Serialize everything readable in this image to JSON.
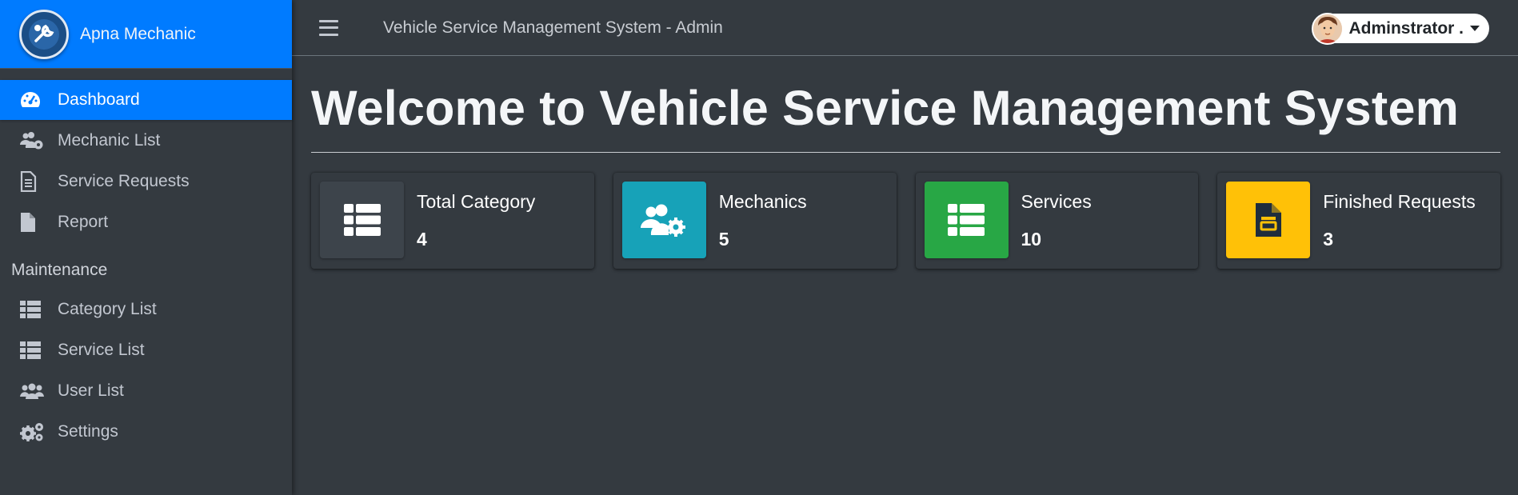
{
  "brand": {
    "name": "Apna Mechanic"
  },
  "header": {
    "title": "Vehicle Service Management System - Admin",
    "user_name": "Adminstrator ."
  },
  "sidebar": {
    "items": [
      {
        "label": "Dashboard",
        "icon": "tachometer-icon"
      },
      {
        "label": "Mechanic List",
        "icon": "users-cog-icon"
      },
      {
        "label": "Service Requests",
        "icon": "file-alt-icon"
      },
      {
        "label": "Report",
        "icon": "file-icon"
      }
    ],
    "section_header": "Maintenance",
    "maintenance_items": [
      {
        "label": "Category List",
        "icon": "th-list-icon"
      },
      {
        "label": "Service List",
        "icon": "th-list-icon"
      },
      {
        "label": "User List",
        "icon": "users-icon"
      },
      {
        "label": "Settings",
        "icon": "cogs-icon"
      }
    ]
  },
  "main": {
    "title": "Welcome to Vehicle Service Management System",
    "cards": [
      {
        "label": "Total Category",
        "value": "4",
        "icon": "th-list-icon",
        "color": "#3d444b"
      },
      {
        "label": "Mechanics",
        "value": "5",
        "icon": "users-cog-icon",
        "color": "#17a2b8"
      },
      {
        "label": "Services",
        "value": "10",
        "icon": "th-list-icon",
        "color": "#28a745"
      },
      {
        "label": "Finished Requests",
        "value": "3",
        "icon": "file-alt-icon",
        "color": "#ffc107"
      }
    ]
  },
  "colors": {
    "primary": "#007bff",
    "background": "#343a40",
    "sidebar_text": "#c2c7d0"
  }
}
